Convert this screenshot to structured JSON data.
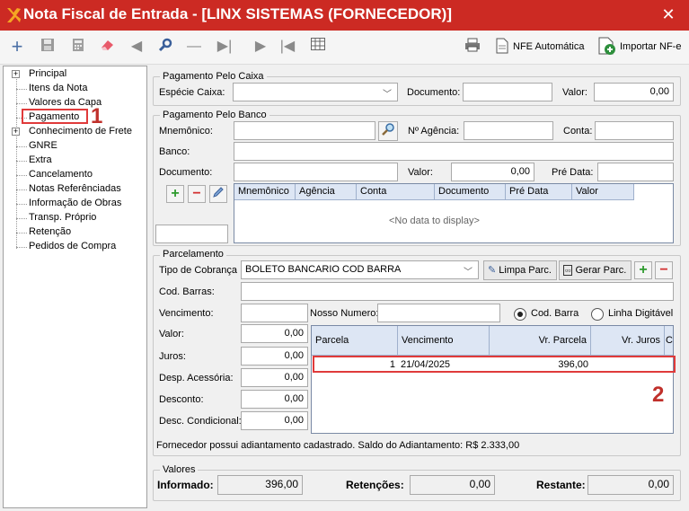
{
  "window": {
    "title": "Nota Fiscal de Entrada - [LINX SISTEMAS (FORNECEDOR)]",
    "close": "✕"
  },
  "toolbar": {
    "nfe_auto_label": "NFE Automática",
    "import_label": "Importar NF-e"
  },
  "tree": {
    "items": [
      "Principal",
      "Itens da Nota",
      "Valores da Capa",
      "Pagamento",
      "Conhecimento de Frete",
      "GNRE",
      "Extra",
      "Cancelamento",
      "Notas Referênciadas",
      "Informação de Obras",
      "Transp. Próprio",
      "Retenção",
      "Pedidos de Compra"
    ],
    "expand": "+"
  },
  "callouts": {
    "one": "1",
    "two": "2"
  },
  "caixa": {
    "title": "Pagamento Pelo Caixa",
    "especie_label": "Espécie Caixa:",
    "especie_value": "",
    "documento_label": "Documento:",
    "documento_value": "",
    "valor_label": "Valor:",
    "valor_value": "0,00"
  },
  "banco": {
    "title": "Pagamento Pelo Banco",
    "mnemonico_label": "Mnemônico:",
    "mnemonico_value": "",
    "agencia_label": "Nº Agência:",
    "agencia_value": "",
    "conta_label": "Conta:",
    "conta_value": "",
    "banco_label": "Banco:",
    "banco_value": "",
    "documento_label": "Documento:",
    "documento_value": "",
    "valor_label": "Valor:",
    "valor_value": "0,00",
    "pre_data_label": "Pré Data:",
    "pre_data_value": "",
    "grid_columns": [
      "Mnemônico",
      "Agência",
      "Conta",
      "Documento",
      "Pré Data",
      "Valor"
    ],
    "grid_empty": "<No data to display>"
  },
  "parcelamento": {
    "title": "Parcelamento",
    "tipo_label": "Tipo de Cobrança",
    "tipo_value": "BOLETO BANCARIO COD BARRA",
    "limpa_label": "Limpa Parc.",
    "gerar_label": "Gerar Parc.",
    "cod_barras_label": "Cod. Barras:",
    "cod_barras_value": "",
    "vencimento_label": "Vencimento:",
    "vencimento_value": "",
    "nosso_numero_label": "Nosso Numero:",
    "nosso_numero_value": "",
    "radio_cod_barra": "Cod. Barra",
    "radio_linha": "Linha Digitável",
    "valor_label": "Valor:",
    "valor_value": "0,00",
    "juros_label": "Juros:",
    "juros_value": "0,00",
    "desp_label": "Desp. Acessória:",
    "desp_value": "0,00",
    "desconto_label": "Desconto:",
    "desconto_value": "0,00",
    "desc_cond_label": "Desc. Condicional:",
    "desc_cond_value": "0,00",
    "grid_columns": [
      "Parcela",
      "Vencimento",
      "Vr. Parcela",
      "Vr. Juros",
      "Co"
    ],
    "rows": [
      {
        "parcela": "1",
        "vencimento": "21/04/2025",
        "vr_parcela": "396,00",
        "vr_juros": ""
      }
    ],
    "info": "Fornecedor possui adiantamento cadastrado. Saldo do Adiantamento: R$ 2.333,00"
  },
  "valores": {
    "title": "Valores",
    "informado_label": "Informado:",
    "informado_value": "396,00",
    "retencoes_label": "Retenções:",
    "retencoes_value": "0,00",
    "restante_label": "Restante:",
    "restante_value": "0,00"
  },
  "colors": {
    "title_bar": "#cc2a23",
    "highlight": "#e03a3a"
  }
}
